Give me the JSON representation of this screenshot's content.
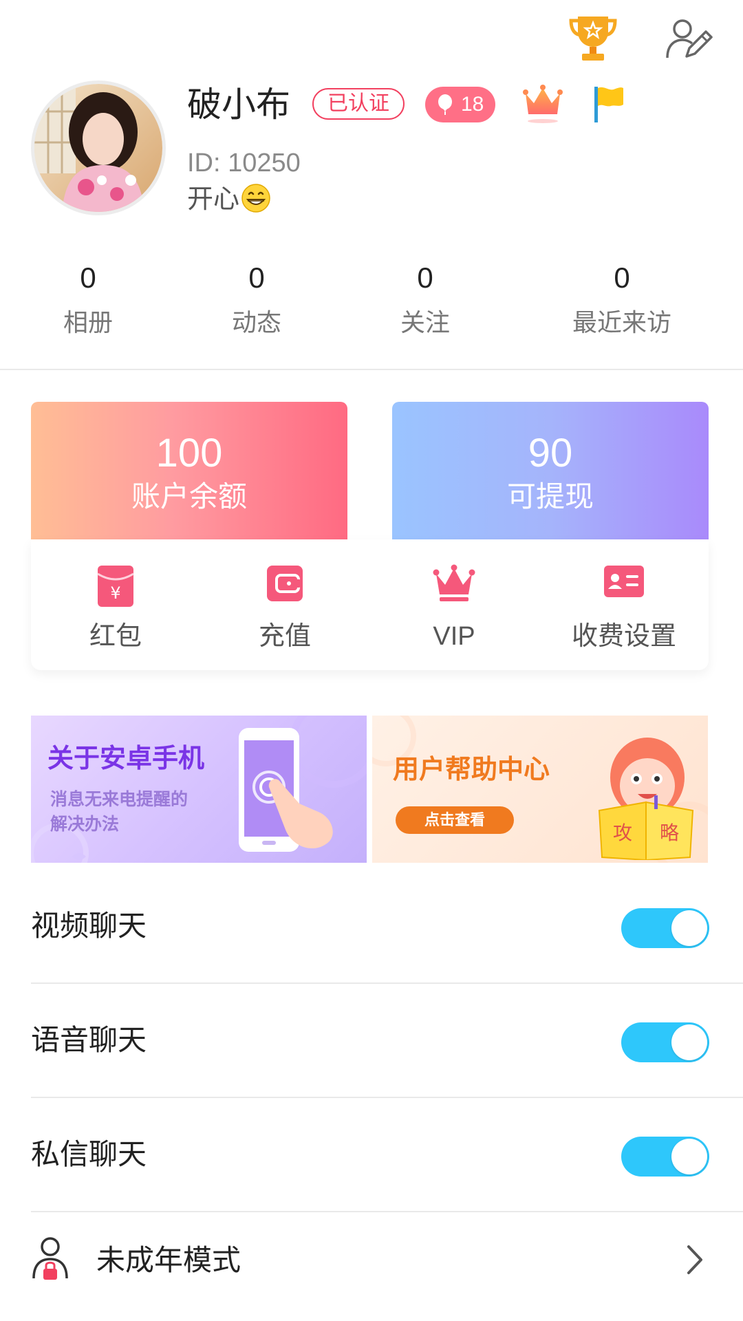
{
  "header": {
    "trophy_icon": "trophy-icon",
    "edit_icon": "edit-profile-icon"
  },
  "profile": {
    "name": "破小布",
    "verified_label": "已认证",
    "level": "18",
    "id_text": "ID: 10250",
    "mood_text": "开心",
    "mood_emoji": "grinning-face-icon",
    "badges": [
      "crown-badge-icon",
      "flag-badge-icon"
    ]
  },
  "stats": [
    {
      "value": "0",
      "label": "相册"
    },
    {
      "value": "0",
      "label": "动态"
    },
    {
      "value": "0",
      "label": "关注"
    },
    {
      "value": "0",
      "label": "最近来访"
    }
  ],
  "wallet": {
    "balance": {
      "amount": "100",
      "label": "账户余额"
    },
    "withdrawable": {
      "amount": "90",
      "label": "可提现"
    }
  },
  "quick_actions": [
    {
      "label": "红包",
      "icon": "red-envelope-icon"
    },
    {
      "label": "充值",
      "icon": "wallet-icon"
    },
    {
      "label": "VIP",
      "icon": "crown-icon"
    },
    {
      "label": "收费设置",
      "icon": "id-card-icon"
    }
  ],
  "banners": {
    "android": {
      "title": "关于安卓手机",
      "subtitle_line1": "消息无来电提醒的",
      "subtitle_line2": "解决办法"
    },
    "help": {
      "title": "用户帮助中心",
      "button": "点击查看",
      "book_left": "攻",
      "book_right": "略"
    }
  },
  "settings": [
    {
      "label": "视频聊天",
      "enabled": true
    },
    {
      "label": "语音聊天",
      "enabled": true
    },
    {
      "label": "私信聊天",
      "enabled": true
    }
  ],
  "minor_mode": {
    "label": "未成年模式"
  },
  "colors": {
    "accent_pink": "#ff6f86",
    "verified_red": "#f2405f",
    "toggle_blue": "#2ec7fb",
    "icon_pink": "#f5587b"
  }
}
